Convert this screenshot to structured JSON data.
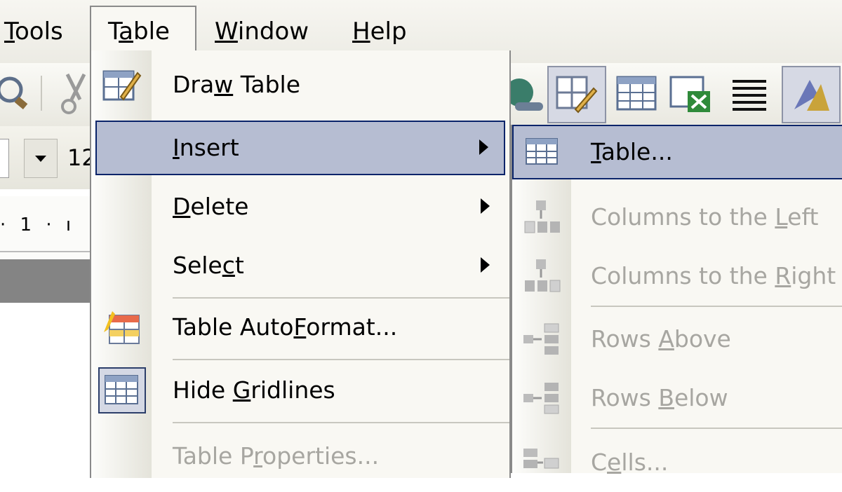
{
  "menubar": {
    "items": [
      {
        "label": "Tools",
        "key": "T"
      },
      {
        "label": "Table",
        "key": "a"
      },
      {
        "label": "Window",
        "key": "W"
      },
      {
        "label": "Help",
        "key": "H"
      }
    ]
  },
  "toolbar": {
    "font_size": "12",
    "ruler_text": "· 1 · ı"
  },
  "table_menu": {
    "items": [
      {
        "pre": "Dra",
        "key": "w",
        "post": " Table"
      },
      {
        "pre": "",
        "key": "I",
        "post": "nsert"
      },
      {
        "pre": "",
        "key": "D",
        "post": "elete"
      },
      {
        "pre": "Sele",
        "key": "c",
        "post": "t"
      },
      {
        "pre": "Table Auto",
        "key": "F",
        "post": "ormat..."
      },
      {
        "pre": "Hide ",
        "key": "G",
        "post": "ridlines"
      },
      {
        "pre": "Table P",
        "key": "r",
        "post": "operties..."
      }
    ]
  },
  "insert_submenu": {
    "items": [
      {
        "pre": "",
        "key": "T",
        "post": "able..."
      },
      {
        "pre": "Columns to the ",
        "key": "L",
        "post": "eft"
      },
      {
        "pre": "Columns to the ",
        "key": "R",
        "post": "ight"
      },
      {
        "pre": "Rows ",
        "key": "A",
        "post": "bove"
      },
      {
        "pre": "Rows ",
        "key": "B",
        "post": "elow"
      },
      {
        "pre": "C",
        "key": "e",
        "post": "lls..."
      }
    ]
  },
  "colors": {
    "highlight": "#b6bdd2",
    "highlight_border": "#0a246a",
    "disabled_text": "#a7a6a1"
  }
}
